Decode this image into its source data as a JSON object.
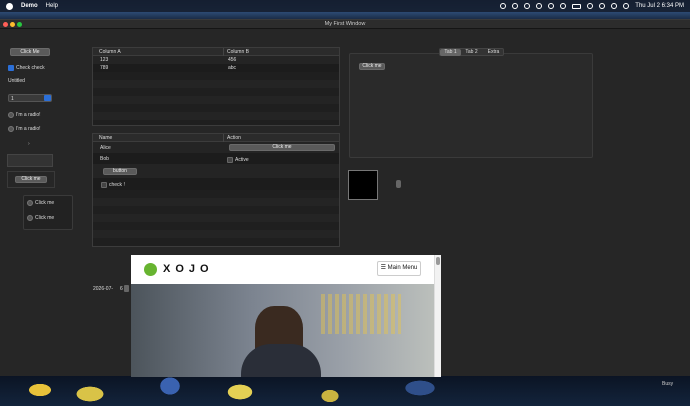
{
  "menubar": {
    "app": "Demo",
    "help": "Help",
    "clock": "Thu Jul 2  6:34 PM"
  },
  "window": {
    "title": "My First Window"
  },
  "left": {
    "click_me_top": "Click Me",
    "check_label": "Check check",
    "untitled": "Untitled",
    "popup_value": "1",
    "radio1": "I'm a radio!",
    "radio2": "I'm a radio!",
    "click_me_small": "Click me",
    "card_click1": "Click me",
    "card_click2": "Click me"
  },
  "list1": {
    "columns": [
      "Column A",
      "Column B"
    ],
    "rows": [
      [
        "123",
        "456"
      ],
      [
        "789",
        "abc"
      ]
    ]
  },
  "list2": {
    "columns": [
      "Name",
      "Action"
    ],
    "rows": [
      "Alice",
      "Bob"
    ],
    "row_button": "Click me",
    "row_check": "Active",
    "inner_button": "button",
    "inner_check": "check !"
  },
  "tabs": {
    "items": [
      "Tab 1",
      "Tab 2",
      "Extra"
    ],
    "tab_button": "Click me"
  },
  "date": {
    "value": "2026-07-",
    "day": "6"
  },
  "web": {
    "brand": "XOJO",
    "menu": "☰ Main Menu"
  },
  "dock_label": "Busy"
}
